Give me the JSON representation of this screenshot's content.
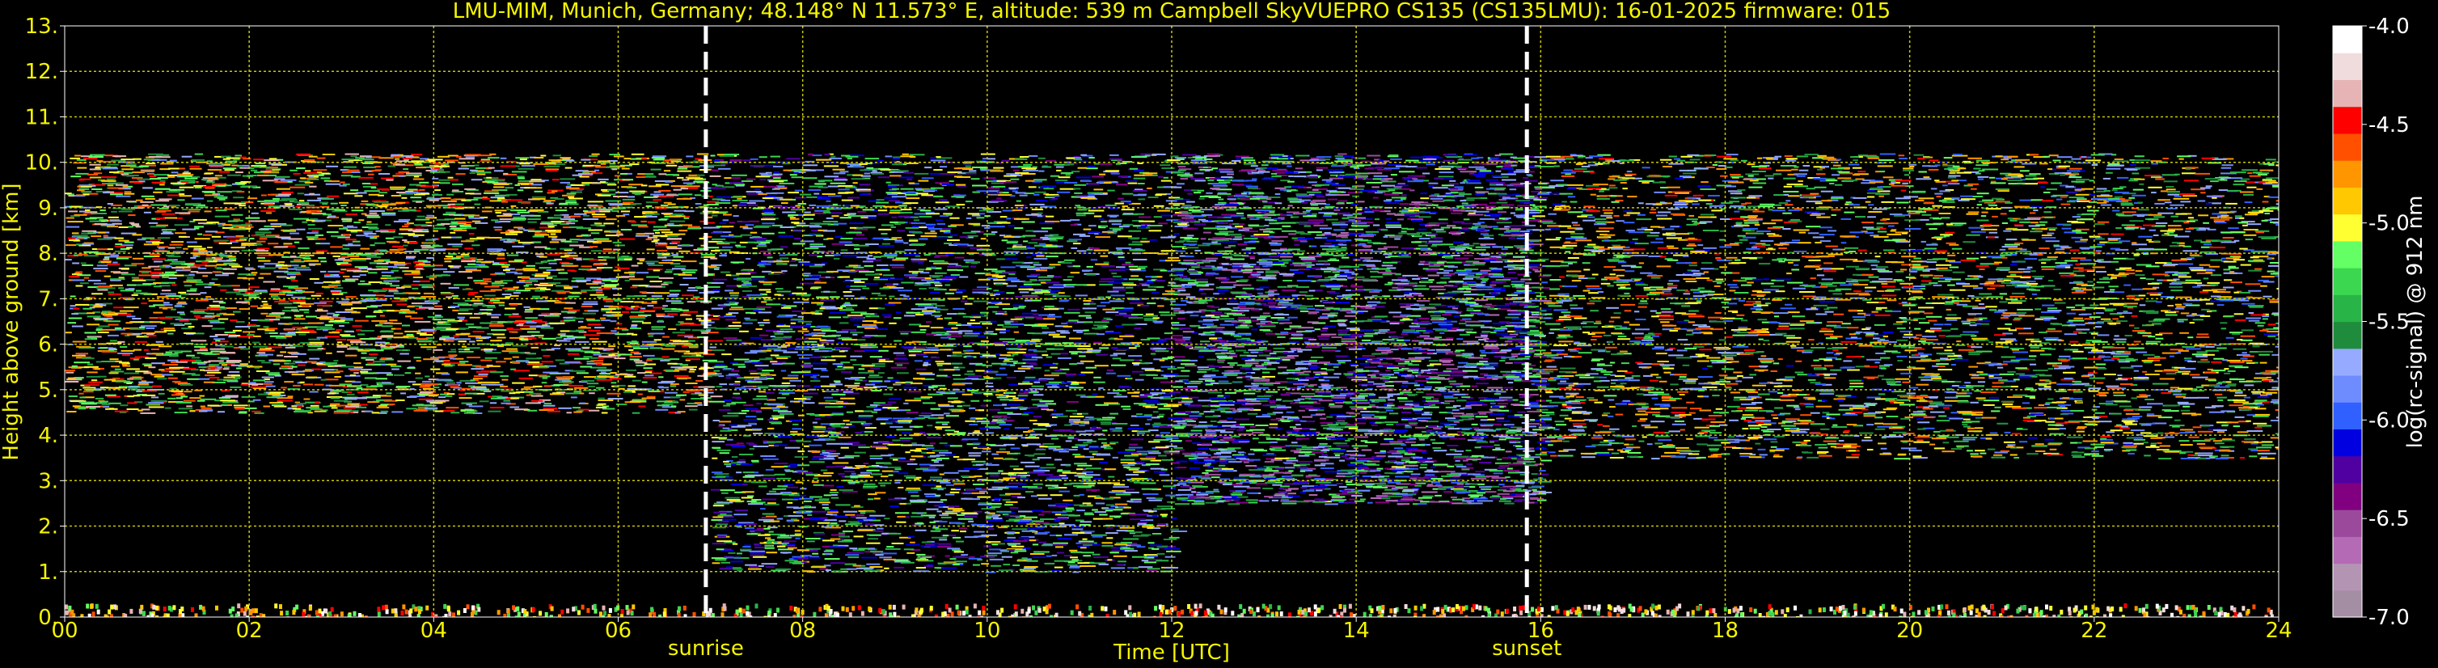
{
  "header": {
    "title": "LMU-MIM, Munich, Germany; 48.148° N 11.573° E, altitude: 539 m    Campbell SkyVUEPRO CS135 (CS135LMU): 16-01-2025    firmware: 015"
  },
  "colors": {
    "background": "#000000",
    "text": "#f5f500",
    "grid": "#c8c800",
    "event_line": "#ffffff"
  },
  "chart_data": {
    "type": "heatmap",
    "title": "LMU-MIM, Munich, Germany; 48.148° N 11.573° E, altitude: 539 m    Campbell SkyVUEPRO CS135 (CS135LMU): 16-01-2025    firmware: 015",
    "xlabel": "Time [UTC]",
    "ylabel": "Height above ground [km]",
    "xlim": [
      0,
      24
    ],
    "ylim": [
      0,
      13
    ],
    "x_ticks": [
      "00",
      "02",
      "04",
      "06",
      "08",
      "10",
      "12",
      "14",
      "16",
      "18",
      "20",
      "22",
      "24"
    ],
    "y_ticks": [
      "0.",
      "1.",
      "2.",
      "3.",
      "4.",
      "5.",
      "6.",
      "7.",
      "8.",
      "9.",
      "10.",
      "11.",
      "12.",
      "13."
    ],
    "grid": true,
    "events": [
      {
        "label": "sunrise",
        "time_utc": 6.95
      },
      {
        "label": "sunset",
        "time_utc": 15.85
      }
    ],
    "colorbar": {
      "label": "log(rc-signal) @ 912 nm",
      "range": [
        -7.0,
        -4.0
      ],
      "ticks": [
        "-4.0",
        "-4.5",
        "-5.0",
        "-5.5",
        "-6.0",
        "-6.5",
        "-7.0"
      ],
      "colors": [
        "#a48ea4",
        "#b394b3",
        "#b56ab5",
        "#9b4a9b",
        "#800080",
        "#5000a0",
        "#0000e0",
        "#3060ff",
        "#6f8cff",
        "#96aaff",
        "#1e8c3c",
        "#28b446",
        "#3cd750",
        "#64ff64",
        "#ffff32",
        "#ffc800",
        "#ff9600",
        "#ff5000",
        "#ff0000",
        "#e6b4b4",
        "#f0dcdc",
        "#ffffff"
      ]
    },
    "signal_layers": [
      {
        "description": "strong near-ground return",
        "height_km": [
          0.0,
          0.3
        ],
        "time_utc": [
          0,
          24
        ],
        "level": -4.0
      },
      {
        "description": "aerosol layer night",
        "height_km": [
          4.5,
          10.2
        ],
        "time_utc": [
          0,
          7
        ],
        "level": -5.0
      },
      {
        "description": "aerosol layer morning",
        "height_km": [
          1.0,
          10.2
        ],
        "time_utc": [
          7,
          12
        ],
        "level": -5.5
      },
      {
        "description": "aerosol layer afternoon",
        "height_km": [
          2.5,
          10.2
        ],
        "time_utc": [
          12,
          16
        ],
        "level": -5.8
      },
      {
        "description": "aerosol layer evening",
        "height_km": [
          3.5,
          10.2
        ],
        "time_utc": [
          16,
          24
        ],
        "level": -5.2
      }
    ]
  }
}
